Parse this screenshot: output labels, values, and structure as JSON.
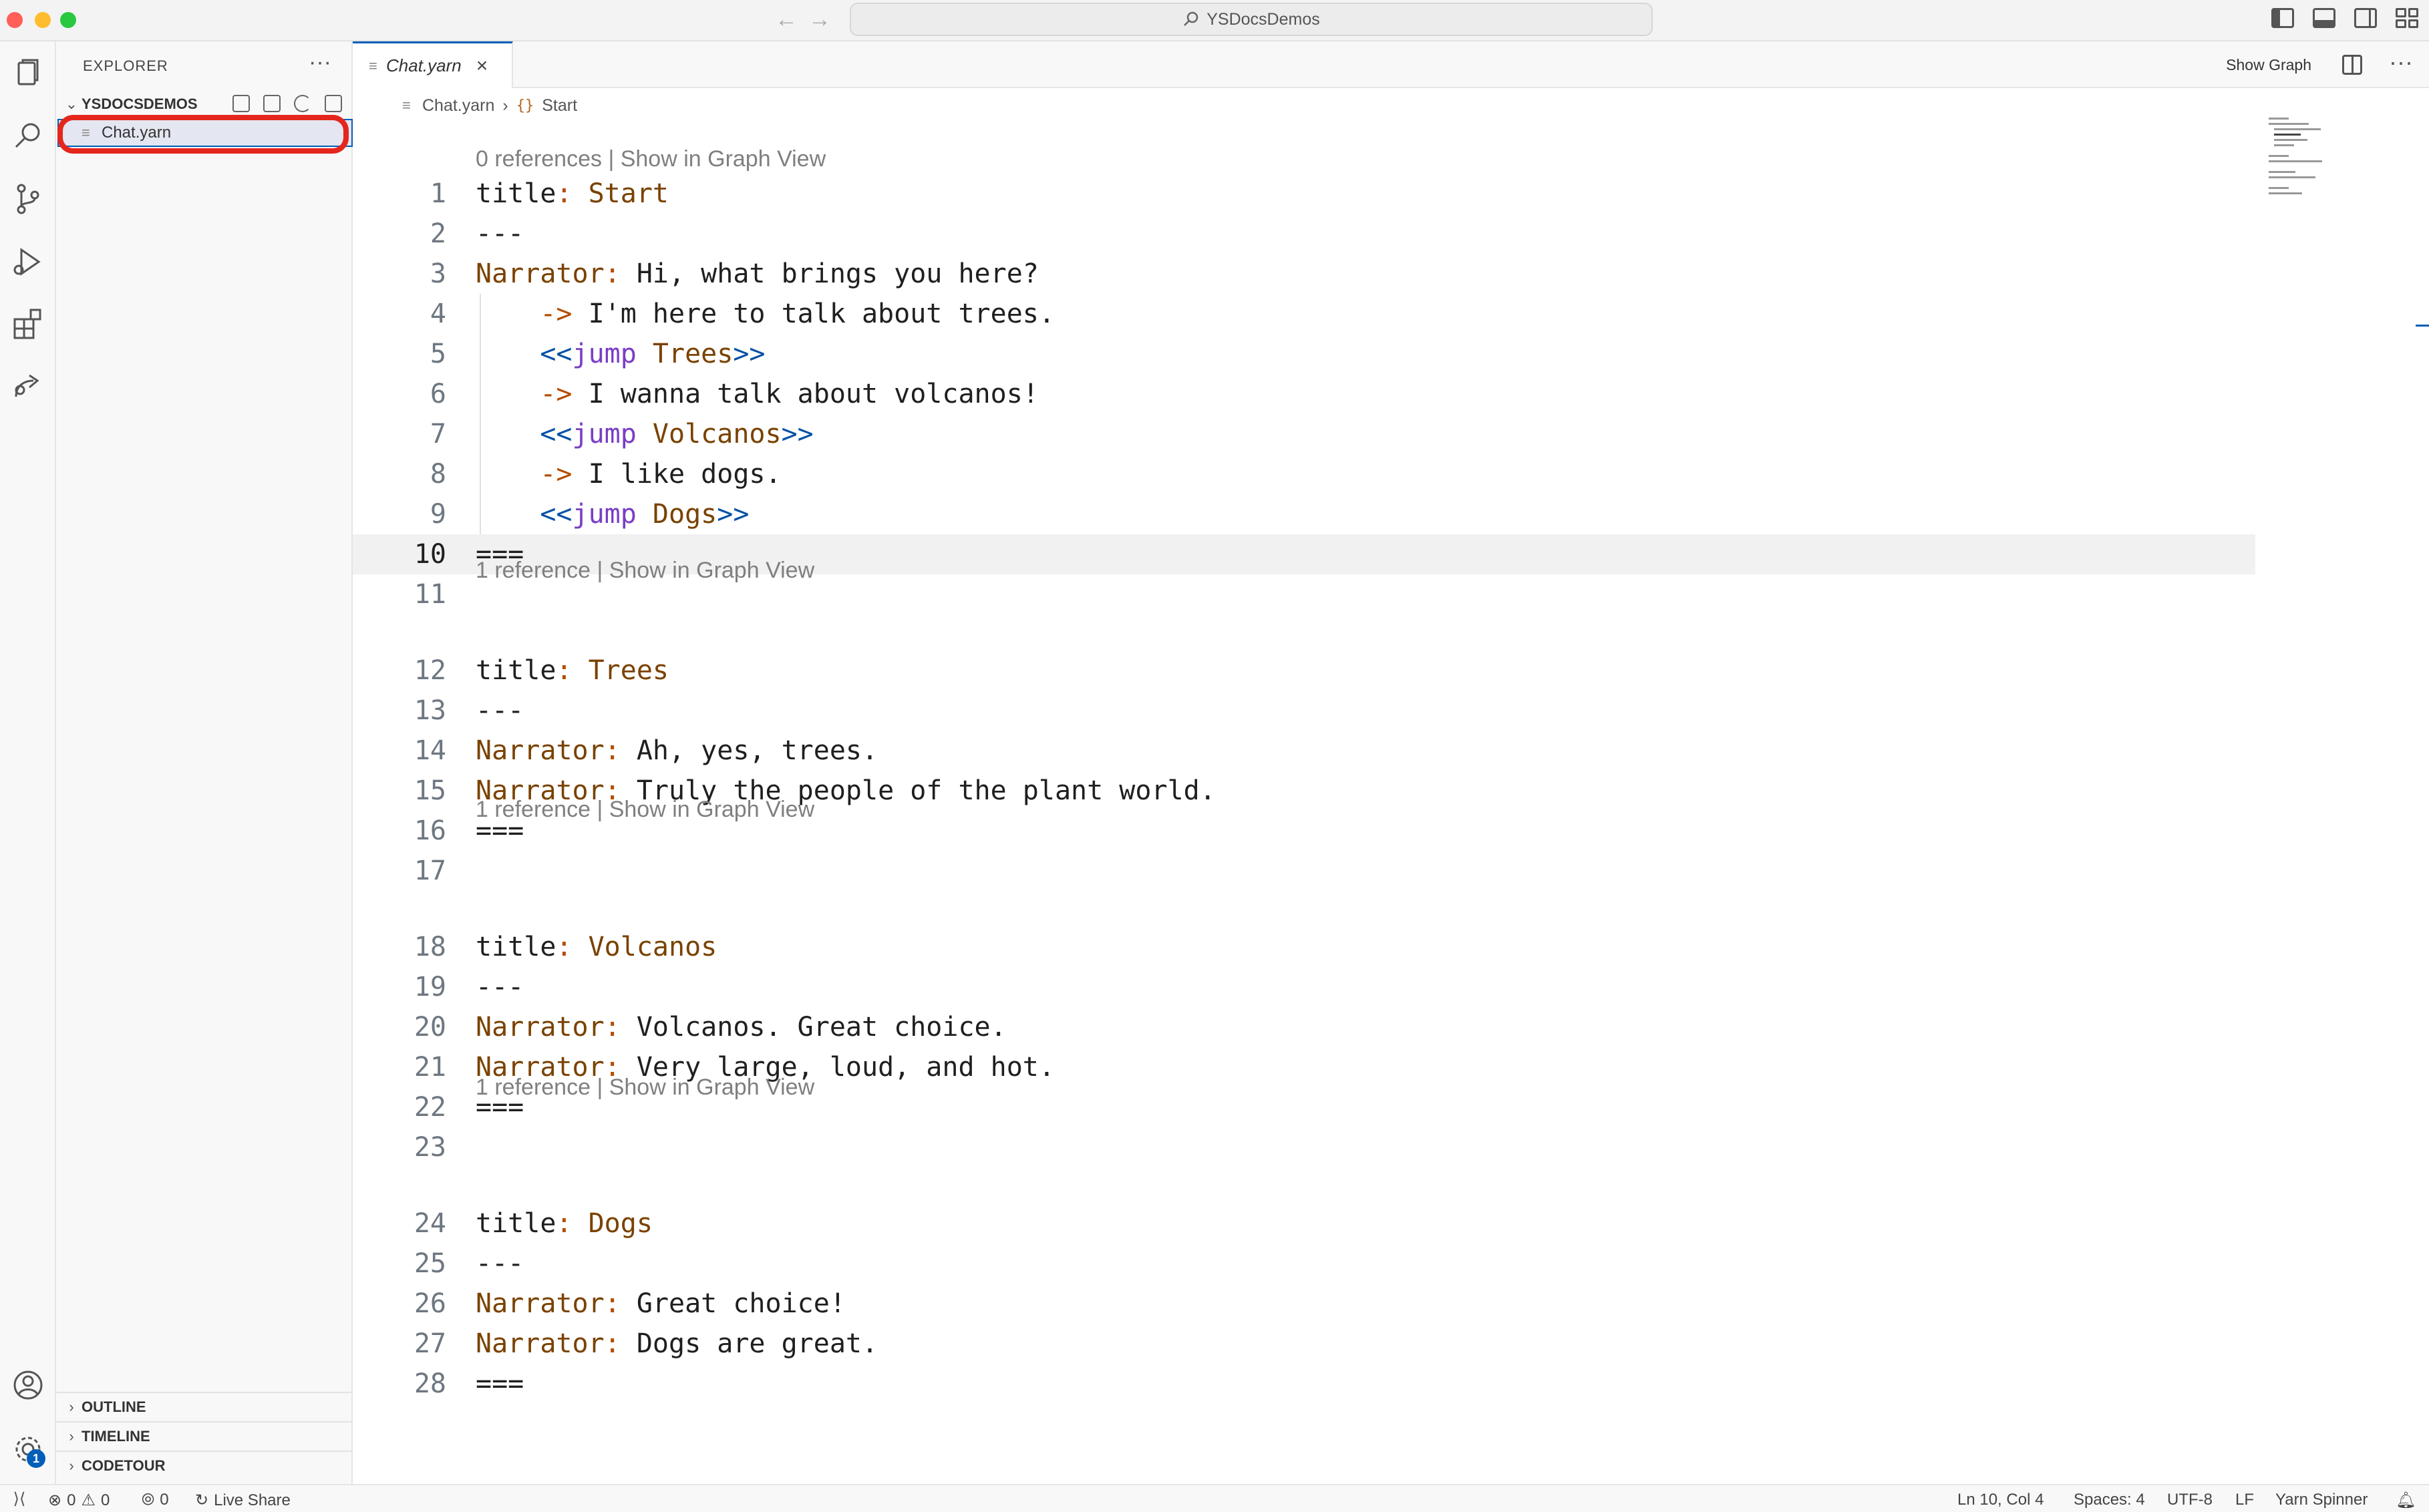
{
  "window": {
    "title": "YSDocsDemos"
  },
  "explorer": {
    "header": "EXPLORER",
    "more": "···",
    "folder": "YSDOCSDEMOS",
    "file": "Chat.yarn",
    "panels": [
      "OUTLINE",
      "TIMELINE",
      "CODETOUR"
    ]
  },
  "editor": {
    "tab_label": "Chat.yarn",
    "show_graph": "Show Graph",
    "breadcrumb_file": "Chat.yarn",
    "breadcrumb_symbol": "Start",
    "lens": {
      "start": "0 references | Show in Graph View",
      "trees": "1 reference | Show in Graph View",
      "volcanos": "1 reference | Show in Graph View",
      "dogs": "1 reference | Show in Graph View"
    },
    "lines": [
      {
        "n": "1",
        "t": [
          [
            "plain",
            "title"
          ],
          [
            "pun",
            ": "
          ],
          [
            "kw",
            "Start"
          ]
        ]
      },
      {
        "n": "2",
        "t": [
          [
            "plain",
            "---"
          ]
        ]
      },
      {
        "n": "3",
        "t": [
          [
            "kw",
            "Narrator"
          ],
          [
            "pun",
            ":"
          ],
          [
            "plain",
            " Hi, what brings you here?"
          ]
        ]
      },
      {
        "n": "4",
        "t": [
          [
            "plain",
            "    "
          ],
          [
            "pun",
            "->"
          ],
          [
            "plain",
            " I'm here to talk about trees."
          ]
        ]
      },
      {
        "n": "5",
        "t": [
          [
            "plain",
            "    "
          ],
          [
            "jmp",
            "<<"
          ],
          [
            "jword",
            "jump"
          ],
          [
            "plain",
            " "
          ],
          [
            "jname",
            "Trees"
          ],
          [
            "jmp",
            ">>"
          ]
        ]
      },
      {
        "n": "6",
        "t": [
          [
            "plain",
            "    "
          ],
          [
            "pun",
            "->"
          ],
          [
            "plain",
            " I wanna talk about volcanos!"
          ]
        ]
      },
      {
        "n": "7",
        "t": [
          [
            "plain",
            "    "
          ],
          [
            "jmp",
            "<<"
          ],
          [
            "jword",
            "jump"
          ],
          [
            "plain",
            " "
          ],
          [
            "jname",
            "Volcanos"
          ],
          [
            "jmp",
            ">>"
          ]
        ]
      },
      {
        "n": "8",
        "t": [
          [
            "plain",
            "    "
          ],
          [
            "pun",
            "->"
          ],
          [
            "plain",
            " I like dogs."
          ]
        ]
      },
      {
        "n": "9",
        "t": [
          [
            "plain",
            "    "
          ],
          [
            "jmp",
            "<<"
          ],
          [
            "jword",
            "jump"
          ],
          [
            "plain",
            " "
          ],
          [
            "jname",
            "Dogs"
          ],
          [
            "jmp",
            ">>"
          ]
        ]
      },
      {
        "n": "10",
        "t": [
          [
            "plain",
            "==="
          ]
        ]
      },
      {
        "n": "11",
        "t": []
      },
      {
        "n": "12",
        "t": [
          [
            "plain",
            "title"
          ],
          [
            "pun",
            ": "
          ],
          [
            "kw",
            "Trees"
          ]
        ]
      },
      {
        "n": "13",
        "t": [
          [
            "plain",
            "---"
          ]
        ]
      },
      {
        "n": "14",
        "t": [
          [
            "kw",
            "Narrator"
          ],
          [
            "pun",
            ":"
          ],
          [
            "plain",
            " Ah, yes, trees."
          ]
        ]
      },
      {
        "n": "15",
        "t": [
          [
            "kw",
            "Narrator"
          ],
          [
            "pun",
            ":"
          ],
          [
            "plain",
            " Truly the people of the plant world."
          ]
        ]
      },
      {
        "n": "16",
        "t": [
          [
            "plain",
            "==="
          ]
        ]
      },
      {
        "n": "17",
        "t": []
      },
      {
        "n": "18",
        "t": [
          [
            "plain",
            "title"
          ],
          [
            "pun",
            ": "
          ],
          [
            "kw",
            "Volcanos"
          ]
        ]
      },
      {
        "n": "19",
        "t": [
          [
            "plain",
            "---"
          ]
        ]
      },
      {
        "n": "20",
        "t": [
          [
            "kw",
            "Narrator"
          ],
          [
            "pun",
            ":"
          ],
          [
            "plain",
            " Volcanos. Great choice."
          ]
        ]
      },
      {
        "n": "21",
        "t": [
          [
            "kw",
            "Narrator"
          ],
          [
            "pun",
            ":"
          ],
          [
            "plain",
            " Very large, loud, and hot."
          ]
        ]
      },
      {
        "n": "22",
        "t": [
          [
            "plain",
            "==="
          ]
        ]
      },
      {
        "n": "23",
        "t": []
      },
      {
        "n": "24",
        "t": [
          [
            "plain",
            "title"
          ],
          [
            "pun",
            ": "
          ],
          [
            "kw",
            "Dogs"
          ]
        ]
      },
      {
        "n": "25",
        "t": [
          [
            "plain",
            "---"
          ]
        ]
      },
      {
        "n": "26",
        "t": [
          [
            "kw",
            "Narrator"
          ],
          [
            "pun",
            ":"
          ],
          [
            "plain",
            " Great choice!"
          ]
        ]
      },
      {
        "n": "27",
        "t": [
          [
            "kw",
            "Narrator"
          ],
          [
            "pun",
            ":"
          ],
          [
            "plain",
            " Dogs are great."
          ]
        ]
      },
      {
        "n": "28",
        "t": [
          [
            "plain",
            "==="
          ]
        ]
      }
    ]
  },
  "status": {
    "errors": "0",
    "warnings": "0",
    "ports": "0",
    "live_share": "Live Share",
    "position": "Ln 10, Col 4",
    "spaces": "Spaces: 4",
    "encoding": "UTF-8",
    "eol": "LF",
    "language": "Yarn Spinner"
  },
  "activity": {
    "settings_badge": "1"
  },
  "colors": {
    "accent": "#005fb8",
    "highlight_ring": "#e5261d",
    "keyword": "#7a4200",
    "jump": "#0451a5"
  }
}
